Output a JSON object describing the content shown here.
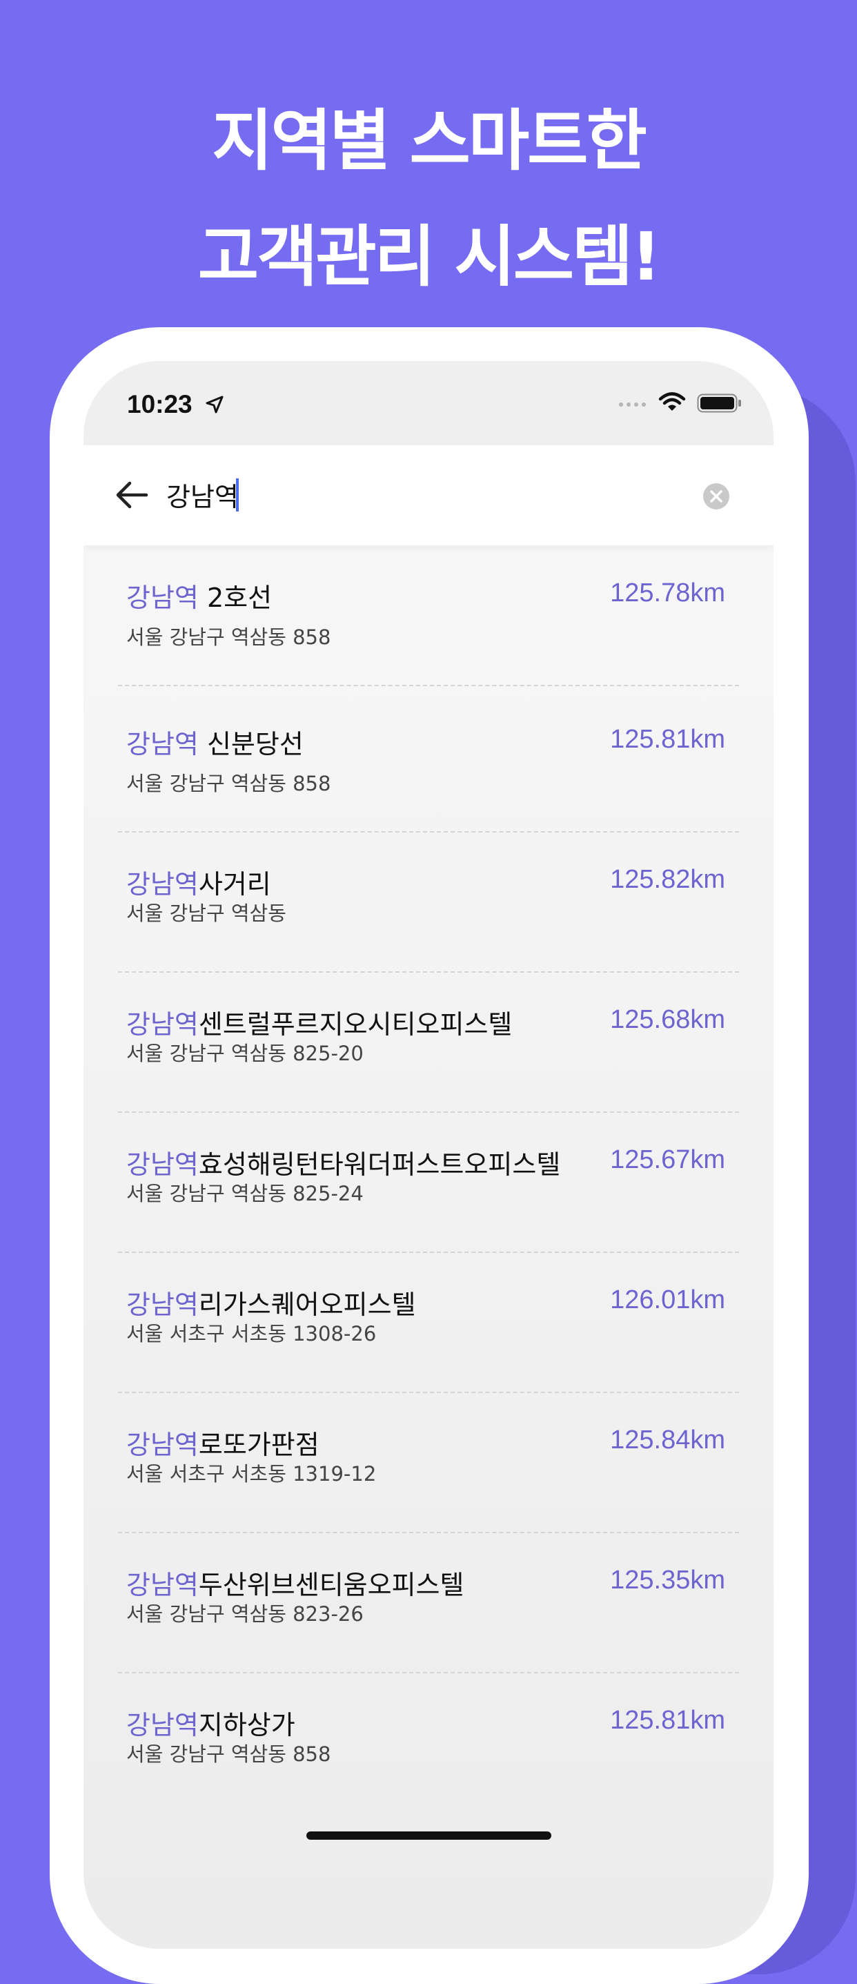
{
  "headline": {
    "line1": "지역별 스마트한",
    "line2": "고객관리 시스템!"
  },
  "status_bar": {
    "time": "10:23"
  },
  "search": {
    "query": "강남역"
  },
  "results": [
    {
      "highlight": "강남역",
      "rest": " 2호선",
      "address": "서울 강남구 역삼동 858",
      "distance": "125.78km"
    },
    {
      "highlight": "강남역",
      "rest": " 신분당선",
      "address": "서울 강남구 역삼동 858",
      "distance": "125.81km"
    },
    {
      "highlight": "강남역",
      "rest": "사거리",
      "address": "서울 강남구 역삼동",
      "distance": "125.82km"
    },
    {
      "highlight": "강남역",
      "rest": "센트럴푸르지오시티오피스텔",
      "address": "서울 강남구 역삼동 825-20",
      "distance": "125.68km"
    },
    {
      "highlight": "강남역",
      "rest": "효성해링턴타워더퍼스트오피스텔",
      "address": "서울 강남구 역삼동 825-24",
      "distance": "125.67km"
    },
    {
      "highlight": "강남역",
      "rest": "리가스퀘어오피스텔",
      "address": "서울 서초구 서초동 1308-26",
      "distance": "126.01km"
    },
    {
      "highlight": "강남역",
      "rest": "로또가판점",
      "address": "서울 서초구 서초동 1319-12",
      "distance": "125.84km"
    },
    {
      "highlight": "강남역",
      "rest": "두산위브센티움오피스텔",
      "address": "서울 강남구 역삼동 823-26",
      "distance": "125.35km"
    },
    {
      "highlight": "강남역",
      "rest": "지하상가",
      "address": "서울 강남구 역삼동 858",
      "distance": "125.81km"
    }
  ],
  "colors": {
    "background": "#756cf2",
    "accent": "#6e64cf",
    "caret": "#4b6bf0"
  },
  "icons": [
    "location-arrow-icon",
    "cellular-signal-icon",
    "wifi-icon",
    "battery-icon",
    "back-arrow-icon",
    "clear-icon"
  ]
}
